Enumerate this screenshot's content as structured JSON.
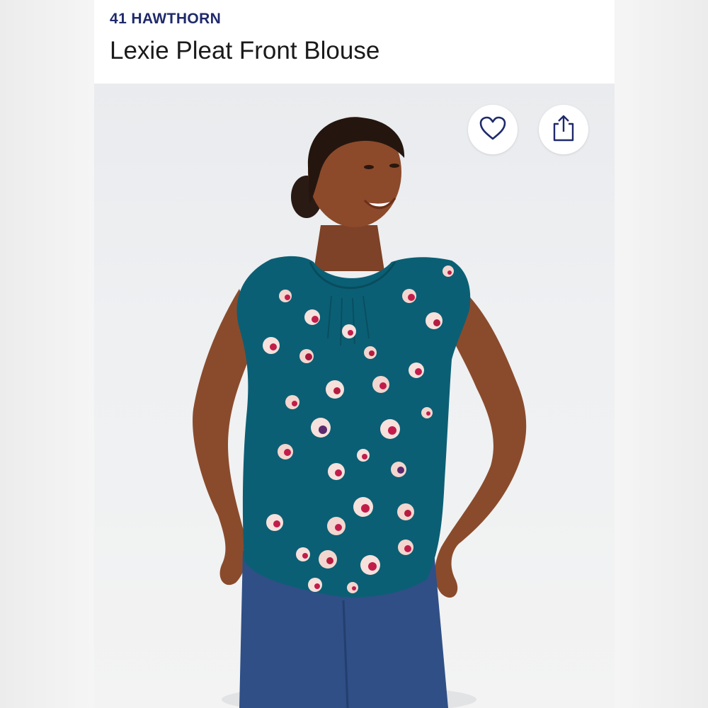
{
  "product": {
    "brand": "41 HAWTHORN",
    "title": "Lexie Pleat Front Blouse"
  },
  "actions": {
    "favorite_icon": "heart-outline-icon",
    "share_icon": "share-upload-icon"
  },
  "image": {
    "subject": "model-photo",
    "top_color": "#0b5f74",
    "jeans_color": "#2f4f86",
    "background": "#eef0f2"
  }
}
